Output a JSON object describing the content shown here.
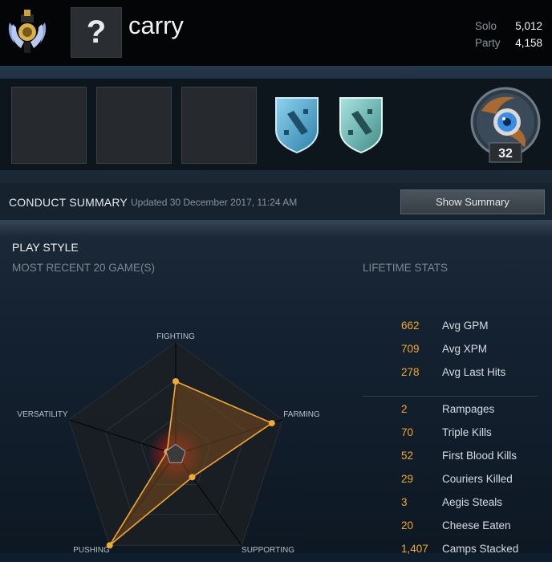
{
  "header": {
    "player_name": "carry",
    "unknown_badge": "?",
    "mmr": [
      {
        "label": "Solo",
        "value": "5,012"
      },
      {
        "label": "Party",
        "value": "4,158"
      }
    ]
  },
  "hero": {
    "level": "32"
  },
  "conduct": {
    "title": "CONDUCT SUMMARY",
    "updated": "Updated 30 December 2017, 11:24 AM",
    "button": "Show Summary"
  },
  "playstyle": {
    "title": "PLAY STYLE",
    "recent_label": "MOST RECENT 20 GAME(S)",
    "lifetime_label": "LIFETIME STATS"
  },
  "chart_data": {
    "type": "radar",
    "axes": [
      "FIGHTING",
      "FARMING",
      "SUPPORTING",
      "PUSHING",
      "VERSATILITY"
    ],
    "values": [
      0.65,
      0.9,
      0.25,
      1.0,
      0.05
    ],
    "range": [
      0,
      1
    ]
  },
  "lifetime_stats": {
    "primary": [
      {
        "value": "662",
        "label": "Avg GPM"
      },
      {
        "value": "709",
        "label": "Avg XPM"
      },
      {
        "value": "278",
        "label": "Avg Last Hits"
      }
    ],
    "secondary": [
      {
        "value": "2",
        "label": "Rampages"
      },
      {
        "value": "70",
        "label": "Triple Kills"
      },
      {
        "value": "52",
        "label": "First Blood Kills"
      },
      {
        "value": "29",
        "label": "Couriers Killed"
      },
      {
        "value": "3",
        "label": "Aegis Steals"
      },
      {
        "value": "20",
        "label": "Cheese Eaten"
      },
      {
        "value": "1,407",
        "label": "Camps Stacked"
      }
    ]
  },
  "colors": {
    "accent": "#f0a838",
    "fill": "#7a4a1e"
  },
  "icons": [
    "rank-emblem-icon",
    "dota-shield-icon",
    "hero-portrait-icon"
  ]
}
